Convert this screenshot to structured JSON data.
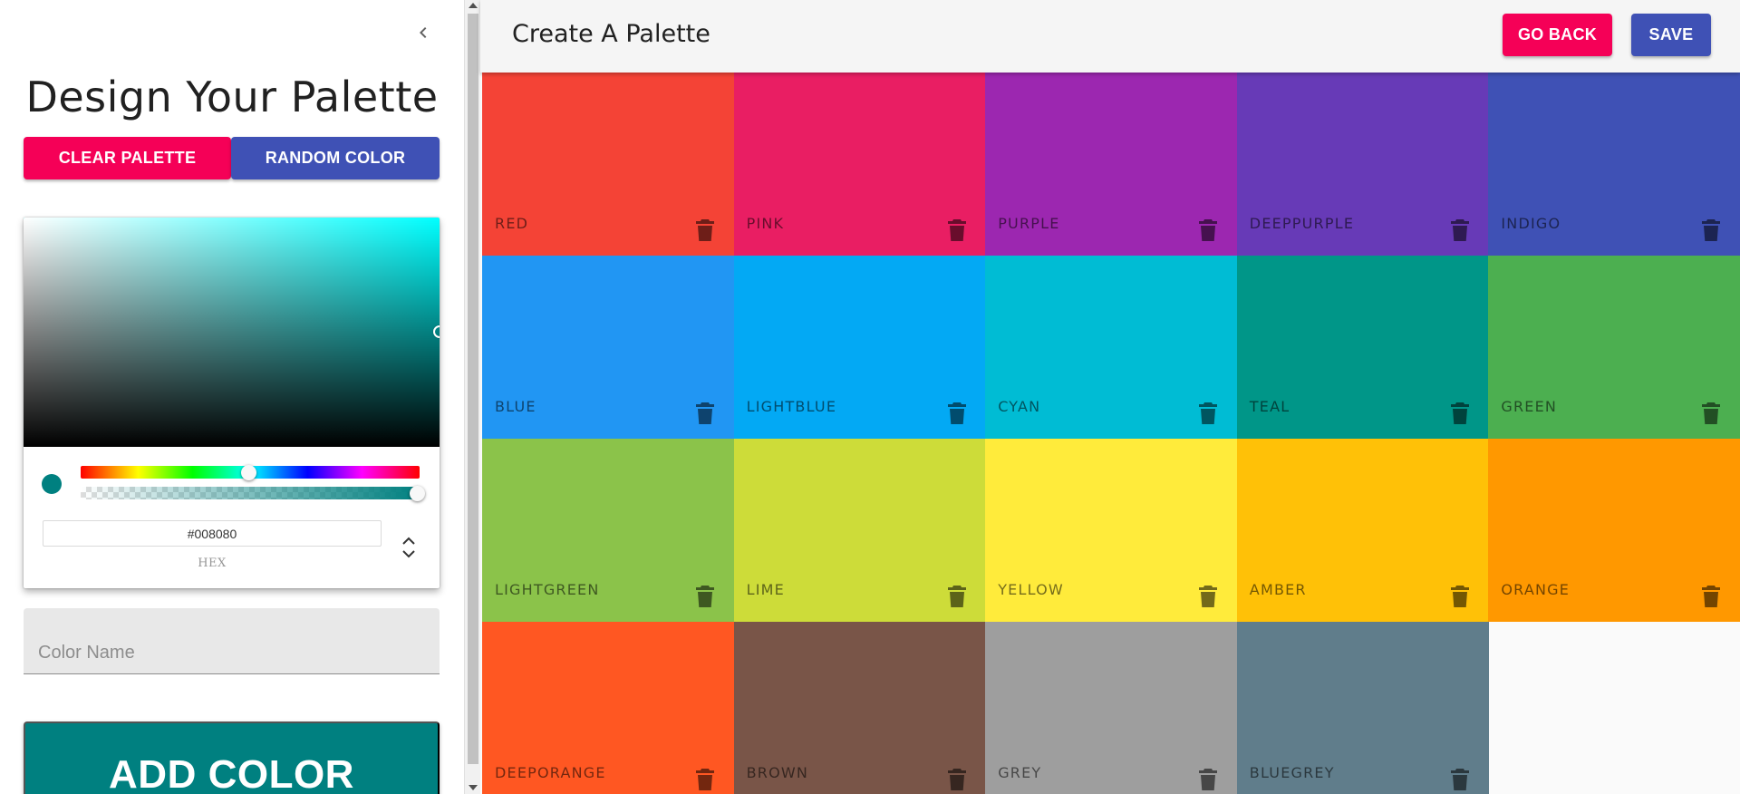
{
  "drawer": {
    "title": "Design Your Palette",
    "clear_label": "CLEAR PALETTE",
    "random_label": "RANDOM COLOR",
    "picker": {
      "hex_value": "#008080",
      "hex_label": "HEX",
      "current_color": "#008080"
    },
    "color_name_placeholder": "Color Name",
    "add_label": "ADD COLOR",
    "add_color": "#008080"
  },
  "appbar": {
    "title": "Create A Palette",
    "back_label": "GO BACK",
    "save_label": "SAVE"
  },
  "icons": {
    "drawer_close": "chevron-left-icon",
    "delete": "trash-icon",
    "format_toggle": "unfold-icon"
  },
  "palette": [
    {
      "name": "red",
      "color": "#f44336"
    },
    {
      "name": "pink",
      "color": "#e91e63"
    },
    {
      "name": "purple",
      "color": "#9c27b0"
    },
    {
      "name": "deeppurple",
      "color": "#673ab7"
    },
    {
      "name": "indigo",
      "color": "#3f51b5"
    },
    {
      "name": "blue",
      "color": "#2196f3"
    },
    {
      "name": "lightblue",
      "color": "#03a9f4"
    },
    {
      "name": "cyan",
      "color": "#00bcd4"
    },
    {
      "name": "teal",
      "color": "#009688"
    },
    {
      "name": "green",
      "color": "#4caf50"
    },
    {
      "name": "lightgreen",
      "color": "#8bc34a"
    },
    {
      "name": "lime",
      "color": "#cddc39"
    },
    {
      "name": "yellow",
      "color": "#ffeb3b"
    },
    {
      "name": "amber",
      "color": "#ffc107"
    },
    {
      "name": "orange",
      "color": "#ff9800"
    },
    {
      "name": "deeporange",
      "color": "#ff5722"
    },
    {
      "name": "brown",
      "color": "#795548"
    },
    {
      "name": "grey",
      "color": "#9e9e9e"
    },
    {
      "name": "bluegrey",
      "color": "#607d8b"
    }
  ]
}
